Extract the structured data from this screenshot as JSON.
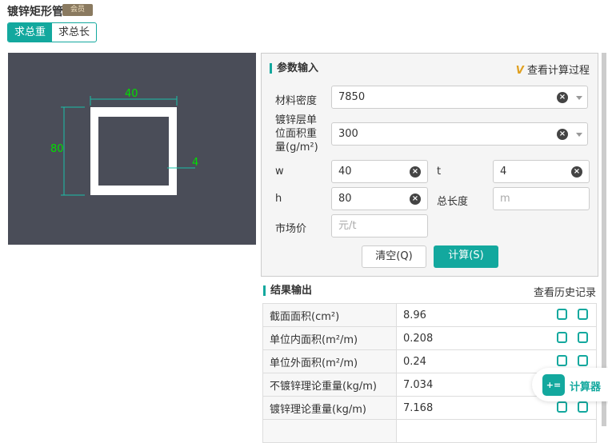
{
  "header": {
    "title": "镀锌矩形管",
    "vip_badge": "会员"
  },
  "tabs": [
    {
      "label": "求总重",
      "active": true
    },
    {
      "label": "求总长",
      "active": false
    }
  ],
  "diagram": {
    "width_label": "40",
    "height_label": "80",
    "thickness_label": "4"
  },
  "params": {
    "title": "参数输入",
    "view_process": "查看计算过程",
    "density": {
      "label": "材料密度",
      "value": "7850"
    },
    "coating": {
      "label": "镀锌层单位面积重量(g/m²)",
      "value": "300"
    },
    "w": {
      "label": "w",
      "value": "40"
    },
    "t": {
      "label": "t",
      "value": "4"
    },
    "h": {
      "label": "h",
      "value": "80"
    },
    "total_length": {
      "label": "总长度",
      "placeholder": "m"
    },
    "price": {
      "label": "市场价",
      "placeholder": "元/t"
    },
    "clear_label": "清空(Q)",
    "calc_label": "计算(S)"
  },
  "results": {
    "title": "结果输出",
    "history": "查看历史记录",
    "rows": [
      {
        "k": "截面面积(cm²)",
        "v": "8.96"
      },
      {
        "k": "单位内面积(m²/m)",
        "v": "0.208"
      },
      {
        "k": "单位外面积(m²/m)",
        "v": "0.24"
      },
      {
        "k": "不镀锌理论重量(kg/m)",
        "v": "7.034"
      },
      {
        "k": "镀锌理论重量(kg/m)",
        "v": "7.168"
      },
      {
        "k": "",
        "v": ""
      }
    ]
  },
  "calculator": {
    "label": "计算器"
  },
  "colors": {
    "accent": "#13a89e",
    "diagram_bg": "#4a4d58",
    "dimension": "#00e000"
  }
}
